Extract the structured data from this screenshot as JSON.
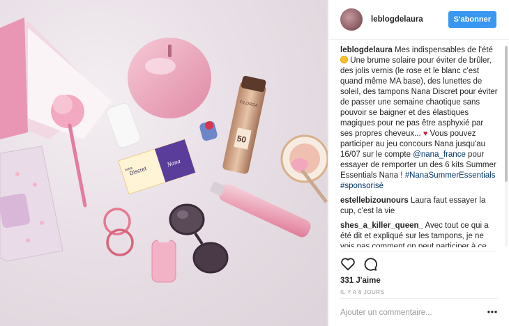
{
  "post": {
    "username": "leblogdelaura",
    "follow_label": "S'abonner",
    "caption": {
      "author": "leblogdelaura",
      "part1": "Mes indispensables de l'été",
      "part2": "Une brume solaire pour éviter de brûler, des jolis vernis (le rose et le blanc c'est quand même MA base), des lunettes de soleil, des tampons Nana Discret pour éviter de passer une semaine chaotique sans pouvoir se baigner et des élastiques magiques pour ne pas être asphyxié par ses propres cheveux...",
      "part3": "Vous pouvez participer au jeu concours Nana jusqu'au 16/07 sur le compte",
      "mention": "@nana_france",
      "part4": "pour essayer de remporter un des 6 kits Summer Essentials Nana !",
      "hashtag1": "#NanaSummerEssentials",
      "hashtag2": "#sponsorisé",
      "emoji1": "sun-emoji",
      "emoji2": "broken-heart-emoji"
    },
    "comments": [
      {
        "user": "estellebizounours",
        "text": "Laura faut essayer la cup, c'est la vie"
      },
      {
        "user": "shes_a_killer_queen_",
        "text": "Avec tout ce qui a été dit et expliqué sur les tampons, je ne vois pas comment on peut participer à ce concours :("
      }
    ],
    "likes": "331 J'aime",
    "time": "IL Y A 6 JOURS",
    "add_comment_placeholder": "Ajouter un commentaire...",
    "more_label": "•••",
    "photo_text": {
      "tampon_brand": "Discret",
      "tampon_brand_prefix": "extra",
      "tampon_logo": "Nana",
      "spray_brand": "FILORGA",
      "spray_spf": "50"
    }
  },
  "colors": {
    "follow_button": "#3897f0",
    "link": "#003569",
    "text": "#262626",
    "muted": "#999999"
  }
}
